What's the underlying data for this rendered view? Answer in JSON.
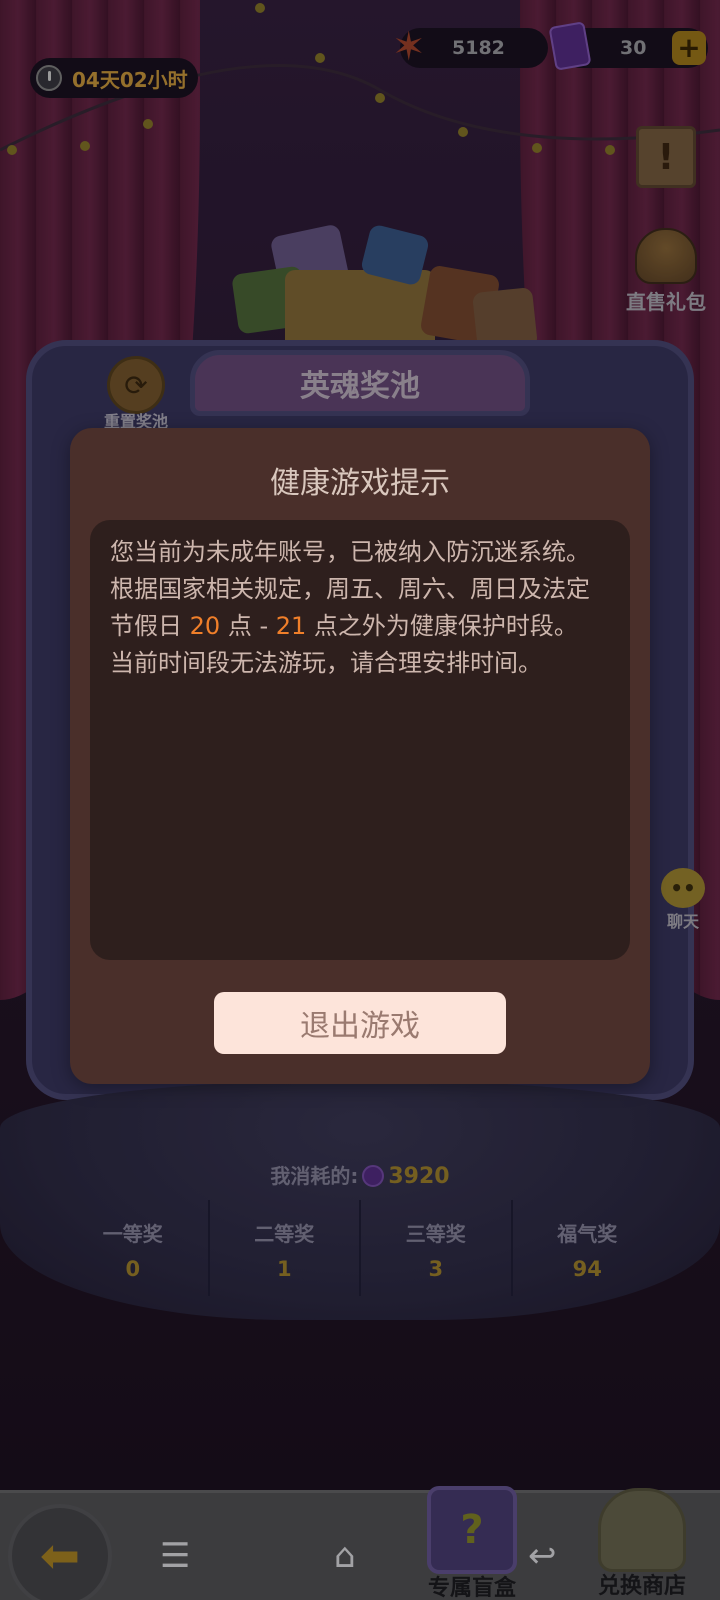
{
  "hud": {
    "timer": "04天02小时",
    "stars": "5182",
    "tickets": "30",
    "plus_label": "+"
  },
  "side": {
    "gift_label": "直售礼包",
    "reset_label": "重置奖池",
    "chat_label": "聊天"
  },
  "machine": {
    "title": "英魂奖池"
  },
  "consume": {
    "label": "我消耗的:",
    "value": "3920"
  },
  "prizes": [
    {
      "name": "一等奖",
      "count": "0"
    },
    {
      "name": "二等奖",
      "count": "1"
    },
    {
      "name": "三等奖",
      "count": "3"
    },
    {
      "name": "福气奖",
      "count": "94"
    }
  ],
  "bottom": {
    "blind_box_label": "专属盲盒",
    "shop_label": "兑换商店"
  },
  "dialog": {
    "title": "健康游戏提示",
    "line1": "您当前为未成年账号，已被纳入防沉迷系统。",
    "line2": "根据国家相关规定，周五、周六、周日及法定",
    "line3_a": "节假日 ",
    "line3_h1": "20",
    "line3_b": " 点 -  ",
    "line3_h2": "21",
    "line3_c": " 点之外为健康保护时段。",
    "line4": "当前时间段无法游玩，请合理安排时间。",
    "exit_label": "退出游戏"
  },
  "colors": {
    "dialog_bg": "#4a2f2a",
    "body_bg": "#2e1f1d",
    "highlight": "#f07f2a",
    "button_bg": "#fde4da"
  }
}
